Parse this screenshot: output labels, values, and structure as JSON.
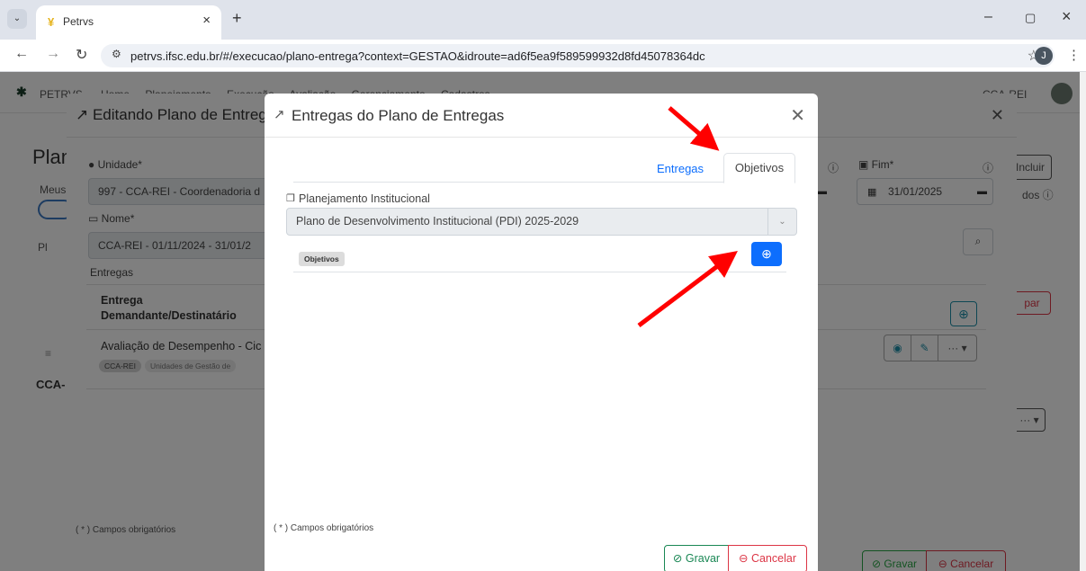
{
  "browser": {
    "tab_menu_icon": "chevron-down",
    "tab_title": "Petrvs",
    "tab_close": "×",
    "new_tab": "+",
    "url": "petrvs.ifsc.edu.br/#/execucao/plano-entrega?context=GESTAO&idroute=ad6f5ea9f589599932d8fd45078364dc",
    "profile_initial": "J",
    "window_buttons": {
      "min": "–",
      "max": "▢",
      "close": "×"
    }
  },
  "app": {
    "brand": "PETRVS",
    "nav": "Home Planejamento Execução Avaliação Gerenciamento Cadastros",
    "user": "CCA-REI",
    "page_title": "Plan",
    "meus_label": "Meus",
    "pl_label": "Pl",
    "cca_label": "CCA-",
    "incluir": "Incluir",
    "dos": "dos ⓘ",
    "par": "par",
    "dots": "··· ▾"
  },
  "modal1": {
    "title": "Editando Plano de Entrega",
    "unidade_label": "Unidade",
    "unidade_value": "997 - CCA-REI - Coordenadoria d",
    "nome_label": "Nome",
    "nome_value": "CCA-REI - 01/11/2024 - 31/01/2",
    "entregas_label": "Entregas",
    "th_entrega": "Entrega",
    "th_demandante": "Demandante/Destinatário",
    "row_text": "Avaliação de Desempenho - Cic",
    "badge1": "CCA-REI",
    "badge2": "Unidades de Gestão de",
    "fim_label": "Fim",
    "fim_value": "31/01/2025",
    "campos": "( * ) Campos obrigatórios",
    "gravar": "Gravar",
    "cancelar": "Cancelar"
  },
  "modal2": {
    "title": "Entregas do Plano de Entregas",
    "tabs": {
      "entregas": "Entregas",
      "objetivos": "Objetivos"
    },
    "planejamento_label": "Planejamento Institucional",
    "planejamento_value": "Plano de Desenvolvimento Institucional (PDI) 2025-2029",
    "objetivos_badge": "Objetivos",
    "campos": "( * ) Campos obrigatórios",
    "gravar": "Gravar",
    "cancelar": "Cancelar"
  },
  "colors": {
    "primary": "#0d6efd",
    "success": "#198754",
    "danger": "#dc3545",
    "arrow": "#ff0000"
  }
}
